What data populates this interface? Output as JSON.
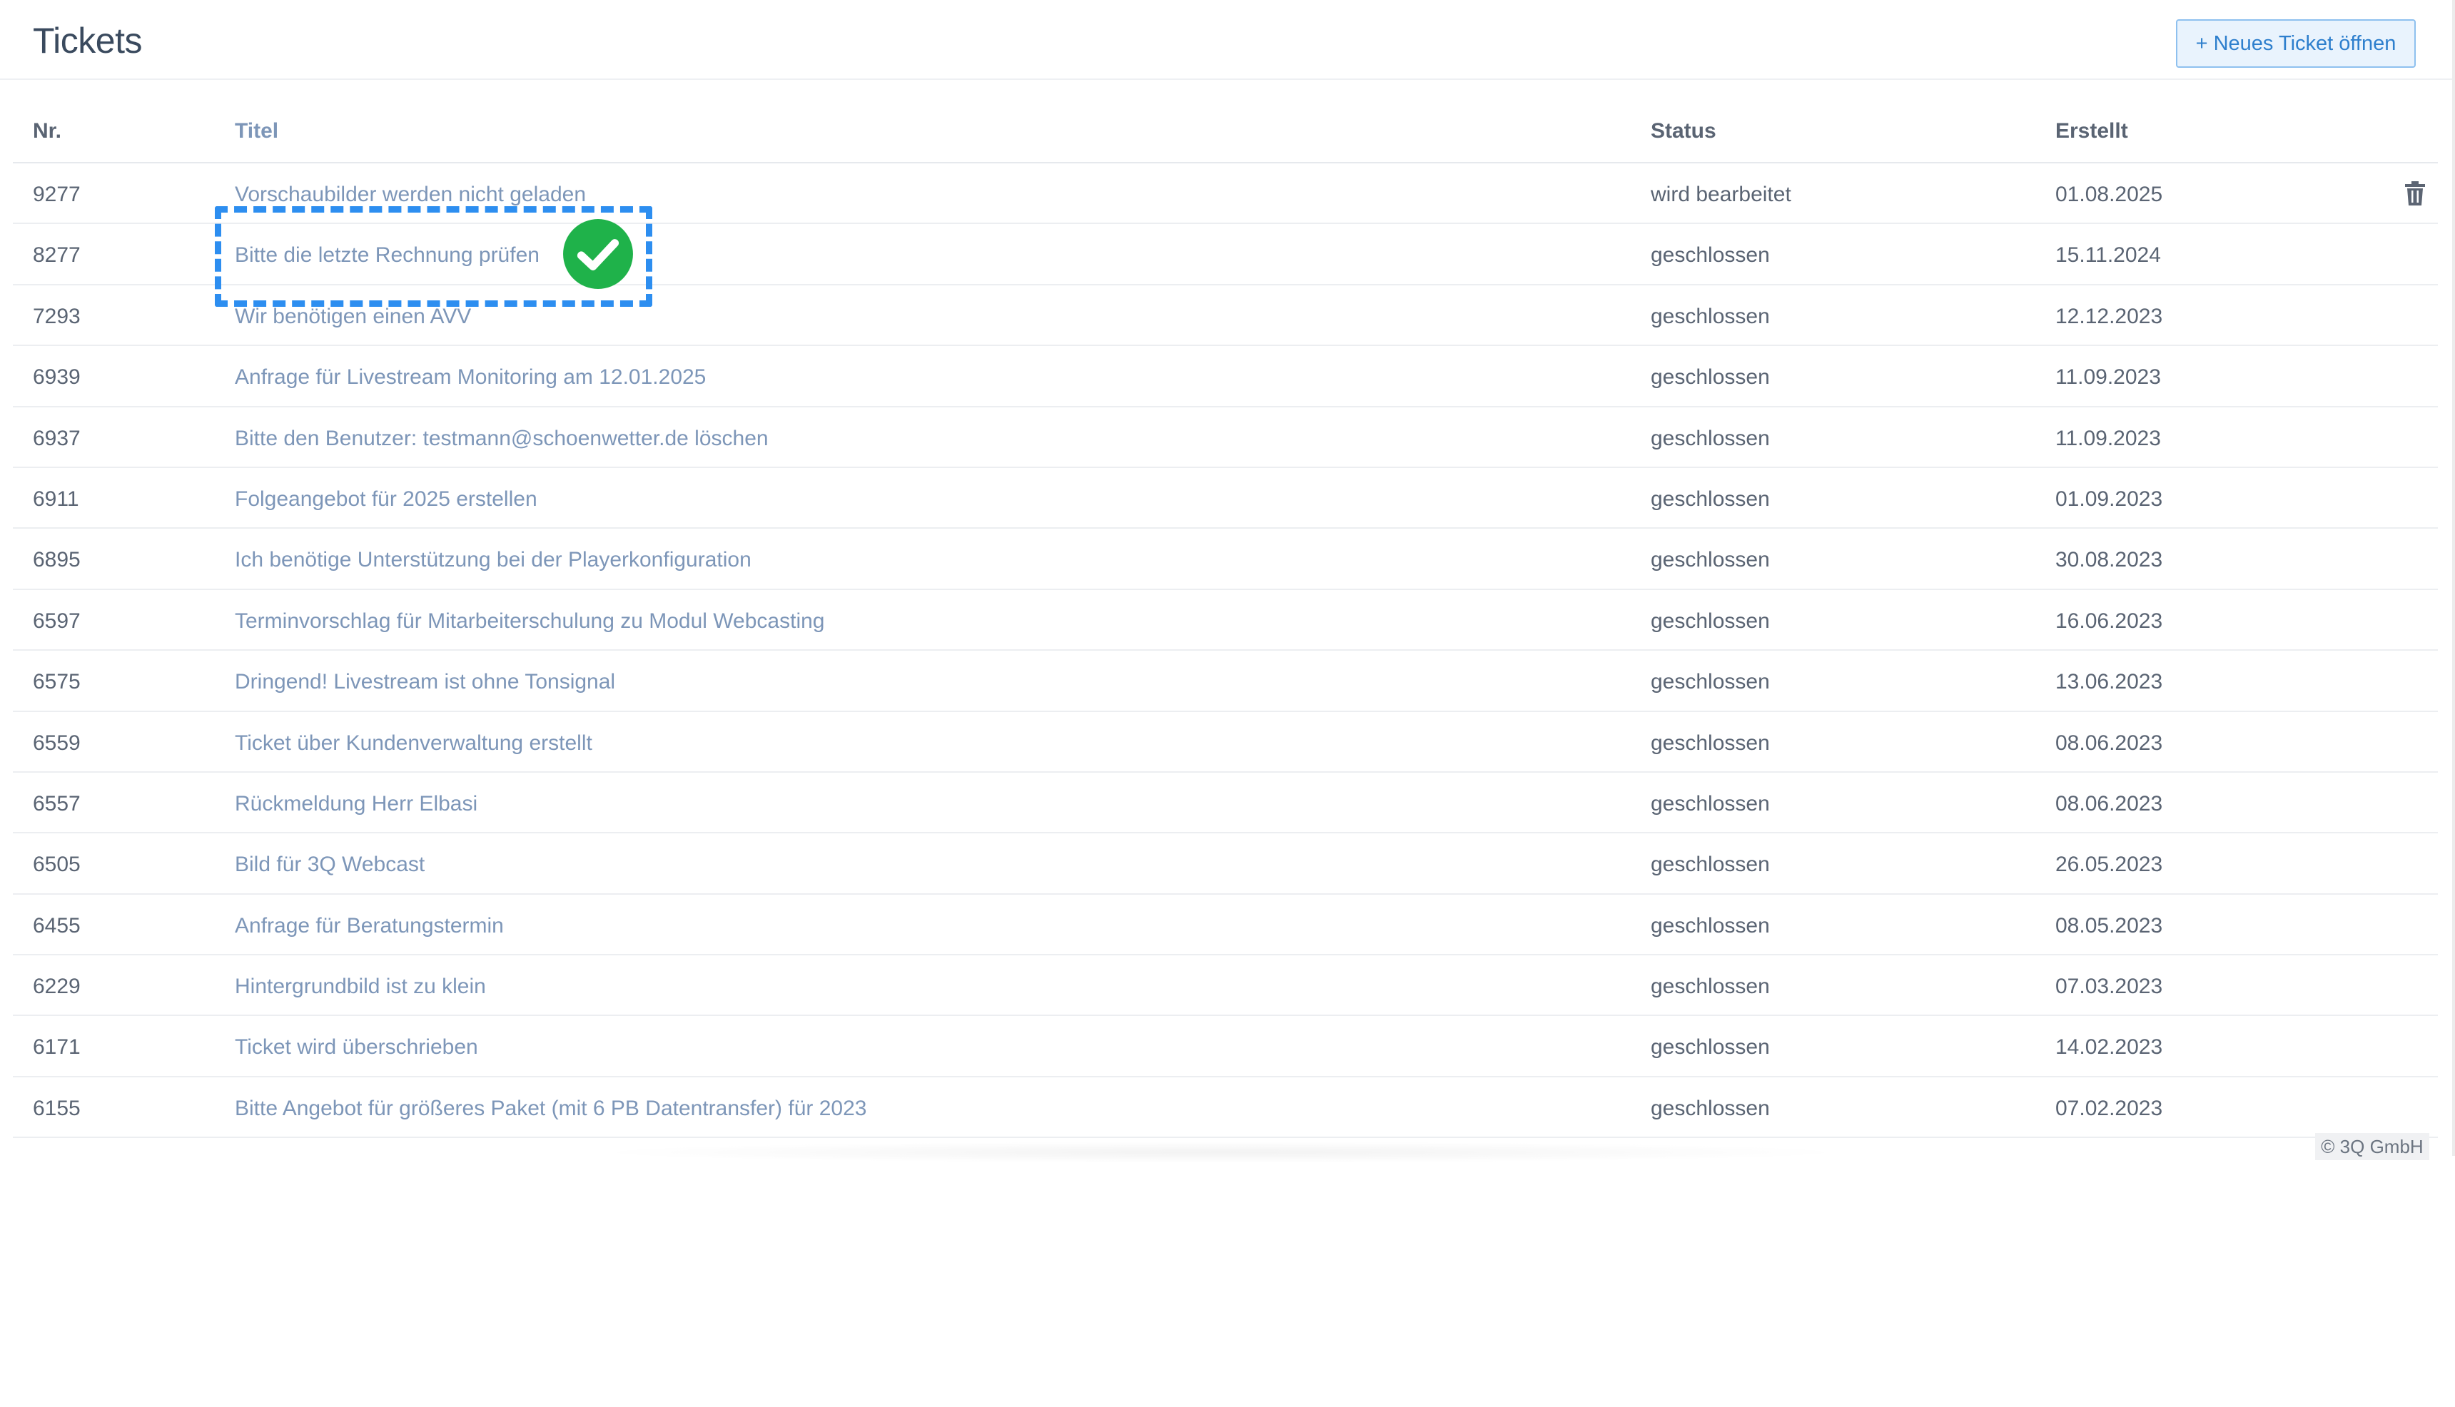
{
  "header": {
    "title": "Tickets",
    "new_ticket_label": "+ Neues Ticket öffnen"
  },
  "table": {
    "columns": {
      "nr": "Nr.",
      "title": "Titel",
      "status": "Status",
      "created": "Erstellt"
    },
    "rows": [
      {
        "nr": "9277",
        "title": "Vorschaubilder werden nicht geladen",
        "status": "wird bearbeitet",
        "created": "01.08.2025"
      },
      {
        "nr": "8277",
        "title": "Bitte die letzte Rechnung prüfen",
        "status": "geschlossen",
        "created": "15.11.2024"
      },
      {
        "nr": "7293",
        "title": "Wir benötigen einen AVV",
        "status": "geschlossen",
        "created": "12.12.2023"
      },
      {
        "nr": "6939",
        "title": "Anfrage für Livestream Monitoring am 12.01.2025",
        "status": "geschlossen",
        "created": "11.09.2023"
      },
      {
        "nr": "6937",
        "title": "Bitte den Benutzer: testmann@schoenwetter.de löschen",
        "status": "geschlossen",
        "created": "11.09.2023"
      },
      {
        "nr": "6911",
        "title": "Folgeangebot für 2025 erstellen",
        "status": "geschlossen",
        "created": "01.09.2023"
      },
      {
        "nr": "6895",
        "title": "Ich benötige Unterstützung bei der Playerkonfiguration",
        "status": "geschlossen",
        "created": "30.08.2023"
      },
      {
        "nr": "6597",
        "title": "Terminvorschlag für Mitarbeiterschulung zu Modul Webcasting",
        "status": "geschlossen",
        "created": "16.06.2023"
      },
      {
        "nr": "6575",
        "title": "Dringend! Livestream ist ohne Tonsignal",
        "status": "geschlossen",
        "created": "13.06.2023"
      },
      {
        "nr": "6559",
        "title": "Ticket über Kundenverwaltung erstellt",
        "status": "geschlossen",
        "created": "08.06.2023"
      },
      {
        "nr": "6557",
        "title": "Rückmeldung Herr Elbasi",
        "status": "geschlossen",
        "created": "08.06.2023"
      },
      {
        "nr": "6505",
        "title": "Bild für 3Q Webcast",
        "status": "geschlossen",
        "created": "26.05.2023"
      },
      {
        "nr": "6455",
        "title": "Anfrage für Beratungstermin",
        "status": "geschlossen",
        "created": "08.05.2023"
      },
      {
        "nr": "6229",
        "title": "Hintergrundbild ist zu klein",
        "status": "geschlossen",
        "created": "07.03.2023"
      },
      {
        "nr": "6171",
        "title": "Ticket wird überschrieben",
        "status": "geschlossen",
        "created": "14.02.2023"
      },
      {
        "nr": "6155",
        "title": "Bitte Angebot für größeres Paket (mit 6 PB Datentransfer) für 2023",
        "status": "geschlossen",
        "created": "07.02.2023"
      }
    ]
  },
  "footer": {
    "copyright": "© 3Q GmbH"
  },
  "icons": {
    "delete": "trash-icon",
    "confirm": "checkmark-icon"
  },
  "colors": {
    "accent": "#2e7fcd",
    "link": "#7d96b8",
    "highlight": "#2d8ef0",
    "check": "#1fb24a"
  }
}
